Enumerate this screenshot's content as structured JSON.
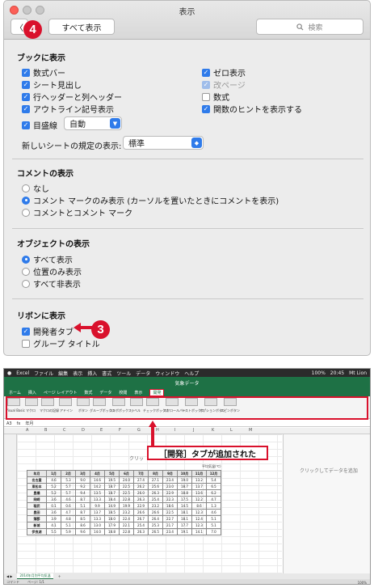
{
  "window": {
    "title": "表示",
    "back": "〈",
    "show_all": "すべて表示",
    "search_placeholder": "検索"
  },
  "badges": {
    "b4": "4",
    "b3": "3"
  },
  "workbook": {
    "heading": "ブックに表示",
    "left": [
      {
        "label": "数式バー",
        "checked": true
      },
      {
        "label": "シート見出し",
        "checked": true
      },
      {
        "label": "行ヘッダーと列ヘッダー",
        "checked": true
      },
      {
        "label": "アウトライン記号表示",
        "checked": true
      }
    ],
    "right": [
      {
        "label": "ゼロ表示",
        "checked": true
      },
      {
        "label": "改ページ",
        "checked": true,
        "disabled": true
      },
      {
        "label": "数式",
        "checked": false
      },
      {
        "label": "関数のヒントを表示する",
        "checked": true
      }
    ],
    "gridlines": {
      "label": "目盛線",
      "value": "自動"
    },
    "default_view": {
      "label": "新しいシートの規定の表示:",
      "value": "標準"
    }
  },
  "comments": {
    "heading": "コメントの表示",
    "options": [
      "なし",
      "コメント マークのみ表示 (カーソルを置いたときにコメントを表示)",
      "コメントとコメント マーク"
    ],
    "selected": 1
  },
  "objects": {
    "heading": "オブジェクトの表示",
    "options": [
      "すべて表示",
      "位置のみ表示",
      "すべて非表示"
    ],
    "selected": 0
  },
  "ribbon": {
    "heading": "リボンに表示",
    "items": [
      {
        "label": "開発者タブ",
        "checked": true
      },
      {
        "label": "グループ タイトル",
        "checked": false
      }
    ]
  },
  "excel": {
    "menubar": [
      "Excel",
      "ファイル",
      "編集",
      "表示",
      "挿入",
      "書式",
      "ツール",
      "データ",
      "ウィンドウ",
      "ヘルプ"
    ],
    "clock": "20:45",
    "user": "Mt Lion",
    "battery": "100%",
    "doc_title": "気象データ",
    "tabs": [
      "ホーム",
      "挿入",
      "ページ レイアウト",
      "数式",
      "データ",
      "校閲",
      "表示",
      "開発"
    ],
    "active_tab": "開発",
    "ribbon_buttons": [
      "Visual Basic",
      "マクロ",
      "マクロの記録",
      "アドイン",
      "ボタン",
      "グループボックス",
      "コンボボックス",
      "ラベル",
      "チェックボックス",
      "スクロールバー",
      "リストボックス",
      "オプションボタン",
      "スピンボタン"
    ],
    "namebox": "A3",
    "formula": "年月",
    "columns": [
      "A",
      "B",
      "C",
      "D",
      "E",
      "F",
      "G",
      "H",
      "I",
      "J",
      "K",
      "L",
      "M"
    ],
    "callout": "［開発］タブが追加された",
    "chart_title": "クリッ",
    "unit": "平均気温(℃)",
    "table_header": [
      "年月",
      "1月",
      "2月",
      "3月",
      "4月",
      "5月",
      "6月",
      "7月",
      "8月",
      "9月",
      "10月",
      "11月",
      "12月"
    ],
    "table_rows": [
      [
        "名古屋",
        "4.6",
        "5.3",
        "9.0",
        "14.6",
        "19.5",
        "24.0",
        "27.4",
        "27.1",
        "23.4",
        "19.0",
        "13.2",
        "5.4"
      ],
      [
        "東松本",
        "5.2",
        "5.7",
        "9.2",
        "14.2",
        "18.7",
        "22.5",
        "26.2",
        "25.6",
        "23.0",
        "18.7",
        "13.7",
        "6.5"
      ],
      [
        "豊橋",
        "5.2",
        "5.7",
        "9.4",
        "13.5",
        "18.7",
        "22.5",
        "26.0",
        "26.3",
        "22.9",
        "18.8",
        "13.6",
        "6.2"
      ],
      [
        "岡崎",
        "3.6",
        "4.6",
        "8.7",
        "13.3",
        "18.4",
        "22.8",
        "26.3",
        "25.4",
        "22.3",
        "17.5",
        "12.2",
        "4.7"
      ],
      [
        "稲武",
        "0.1",
        "0.6",
        "5.1",
        "9.9",
        "14.9",
        "19.9",
        "22.9",
        "23.2",
        "18.6",
        "14.5",
        "8.6",
        "1.3"
      ],
      [
        "豊田",
        "3.6",
        "4.7",
        "8.7",
        "13.7",
        "18.5",
        "23.2",
        "26.6",
        "26.6",
        "22.5",
        "18.1",
        "12.3",
        "4.6"
      ],
      [
        "蒲郡",
        "3.9",
        "4.8",
        "8.5",
        "13.3",
        "18.0",
        "22.4",
        "26.7",
        "26.4",
        "22.7",
        "18.1",
        "12.4",
        "5.1"
      ],
      [
        "新城",
        "4.1",
        "5.1",
        "8.6",
        "13.0",
        "17.9",
        "22.1",
        "25.4",
        "25.3",
        "21.7",
        "17.7",
        "12.3",
        "5.1"
      ],
      [
        "伊良湖",
        "5.5",
        "5.9",
        "9.6",
        "14.0",
        "18.8",
        "22.8",
        "26.3",
        "26.5",
        "23.4",
        "19.1",
        "14.1",
        "7.0"
      ]
    ],
    "side_panel": "クリックしてデータを追加",
    "sheet_tab": "2014年月別平均気温",
    "status_left": "コマンド",
    "status_page": "ページ: 1/1",
    "zoom": "100%"
  }
}
